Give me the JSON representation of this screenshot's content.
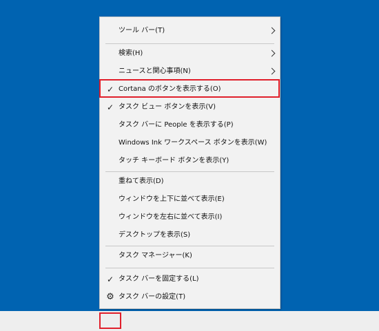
{
  "context_menu": {
    "items": [
      {
        "label": "ツール バー(T)",
        "checked": false,
        "submenu": true
      },
      {
        "label": "検索(H)",
        "checked": false,
        "submenu": true
      },
      {
        "label": "ニュースと関心事項(N)",
        "checked": false,
        "submenu": true
      },
      {
        "label": "Cortana のボタンを表示する(O)",
        "checked": true,
        "submenu": false
      },
      {
        "label": "タスク ビュー ボタンを表示(V)",
        "checked": true,
        "submenu": false
      },
      {
        "label": "タスク バーに People を表示する(P)",
        "checked": false,
        "submenu": false
      },
      {
        "label": "Windows Ink ワークスペース ボタンを表示(W)",
        "checked": false,
        "submenu": false
      },
      {
        "label": "タッチ キーボード ボタンを表示(Y)",
        "checked": false,
        "submenu": false
      },
      {
        "label": "重ねて表示(D)",
        "checked": false,
        "submenu": false
      },
      {
        "label": "ウィンドウを上下に並べて表示(E)",
        "checked": false,
        "submenu": false
      },
      {
        "label": "ウィンドウを左右に並べて表示(I)",
        "checked": false,
        "submenu": false
      },
      {
        "label": "デスクトップを表示(S)",
        "checked": false,
        "submenu": false
      },
      {
        "label": "タスク マネージャー(K)",
        "checked": false,
        "submenu": false
      },
      {
        "label": "タスク バーを固定する(L)",
        "checked": true,
        "submenu": false
      },
      {
        "label": "タスク バーの設定(T)",
        "checked": false,
        "submenu": false,
        "icon": "gear-icon"
      }
    ],
    "check_glyph": "✓",
    "gear_glyph": "⚙"
  },
  "colors": {
    "desktop": "#0063b1",
    "taskbar": "#eeeeee",
    "menu_bg": "#f2f2f2",
    "highlight_border": "#e01e2a"
  }
}
